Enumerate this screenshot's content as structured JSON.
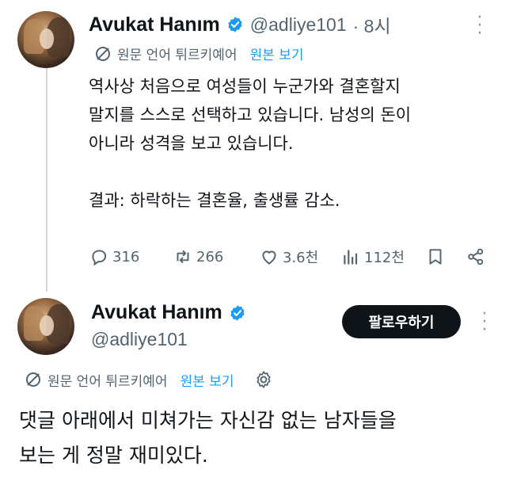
{
  "tweet1": {
    "name": "Avukat Hanım",
    "handle": "@adliye101",
    "time": "· 8시",
    "translate": {
      "label": "원문 언어 튀르키예어",
      "link": "원본 보기"
    },
    "lines": [
      "역사상 처음으로 여성들이 누군가와 결혼할지",
      "말지를 스스로 선택하고 있습니다. 남성의 돈이",
      "아니라 성격을 보고 있습니다.",
      "",
      "결과: 하락하는 결혼율, 출생률 감소."
    ],
    "actions": {
      "replies": "316",
      "retweets": "266",
      "likes": "3.6천",
      "views": "112천"
    }
  },
  "tweet2": {
    "name": "Avukat Hanım",
    "handle": "@adliye101",
    "follow_label": "팔로우하기",
    "translate": {
      "label": "원문 언어 튀르키예어",
      "link": "원본 보기"
    },
    "lines": [
      "댓글 아래에서 미쳐가는 자신감 없는 남자들을",
      "보는 게 정말 재미있다."
    ]
  },
  "colors": {
    "accent": "#1d9bf0",
    "verified": "#1d9bf0",
    "muted": "#536471",
    "text": "#0f1419"
  },
  "icons": [
    "translate-icon",
    "reply-icon",
    "retweet-icon",
    "like-icon",
    "views-icon",
    "bookmark-icon",
    "share-icon",
    "gear-icon",
    "verified-icon",
    "more-icon"
  ]
}
